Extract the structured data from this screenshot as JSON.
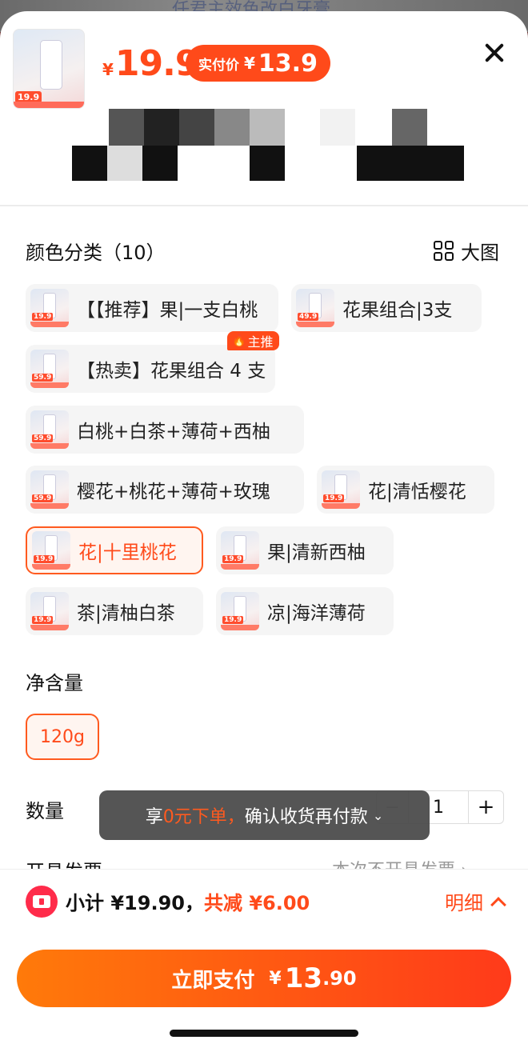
{
  "background": {
    "text": "任君主效色改白牙膏"
  },
  "header": {
    "thumb_price_tag": "19.9",
    "price_symbol": "¥",
    "price": "19.9",
    "paid_label": "实付价",
    "paid_symbol": "¥",
    "paid_price": "13.9"
  },
  "color_section": {
    "title": "颜色分类（10）",
    "big_pic_label": "大图",
    "badge_label": "主推",
    "options": [
      {
        "label": "【【推荐】果|一支白桃",
        "tag": "19.9"
      },
      {
        "label": "花果组合|3支",
        "tag": "49.9"
      },
      {
        "label": "【热卖】花果组合 4 支",
        "tag": "59.9"
      },
      {
        "label": "白桃+白茶+薄荷+西柚",
        "tag": "59.9"
      },
      {
        "label": "樱花+桃花+薄荷+玫瑰",
        "tag": "59.9"
      },
      {
        "label": "花|清恬樱花",
        "tag": "19.9"
      },
      {
        "label": "花|十里桃花",
        "tag": "19.9",
        "selected": true
      },
      {
        "label": "果|清新西柚",
        "tag": "19.9"
      },
      {
        "label": "茶|清柚白茶",
        "tag": "19.9"
      },
      {
        "label": "凉|海洋薄荷",
        "tag": "19.9"
      }
    ]
  },
  "size_section": {
    "title": "净含量",
    "option": "120g"
  },
  "quantity": {
    "label": "数量",
    "value": "1",
    "minus": "−",
    "plus": "+"
  },
  "toast": {
    "prefix": "享",
    "highlight": "0元下单，",
    "suffix": "确认收货再付款",
    "chevron": "⌄"
  },
  "invoice": {
    "label": "开具发票",
    "value": "本次不开具发票 ›"
  },
  "footer": {
    "subtotal_label": "小计 ¥19.90，",
    "discount_label": "共减 ¥6.00",
    "detail_label": "明细",
    "pay_label": "立即支付",
    "pay_symbol": "¥",
    "pay_integer": "13",
    "pay_decimal": ".90"
  },
  "colors": {
    "accent": "#ff4a1a",
    "selected_bg": "#fff5f0",
    "chip_bg": "#f5f5f5"
  }
}
